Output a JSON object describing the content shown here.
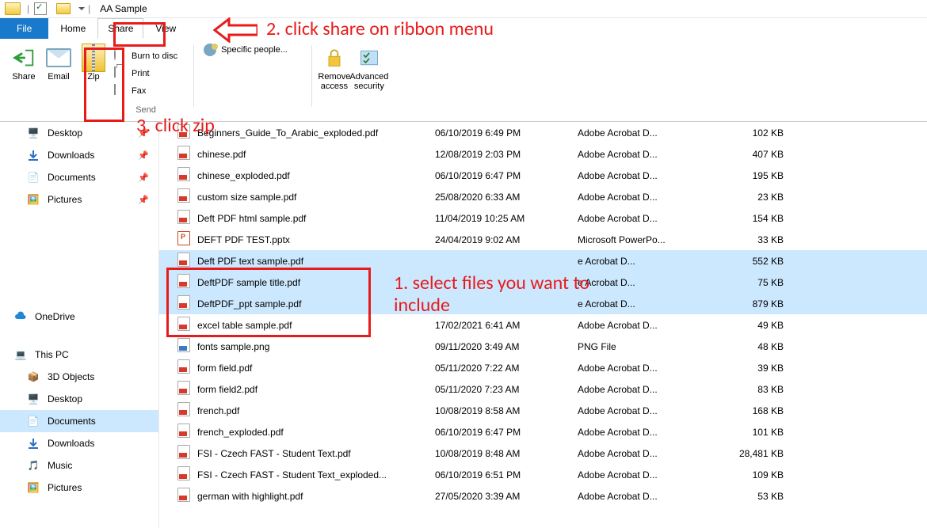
{
  "titlebar": {
    "window_title": "AA Sample"
  },
  "tabs": {
    "file": "File",
    "home": "Home",
    "share": "Share",
    "view": "View"
  },
  "ribbon": {
    "share": "Share",
    "email": "Email",
    "zip": "Zip",
    "burn": "Burn to disc",
    "print": "Print",
    "fax": "Fax",
    "send_group": "Send",
    "specific_people": "Specific people...",
    "remove_access": "Remove access",
    "advanced_security": "Advanced security"
  },
  "nav": {
    "desktop": "Desktop",
    "downloads": "Downloads",
    "documents": "Documents",
    "pictures": "Pictures",
    "onedrive": "OneDrive",
    "this_pc": "This PC",
    "three_d": "3D Objects",
    "desktop2": "Desktop",
    "documents2": "Documents",
    "downloads2": "Downloads",
    "music": "Music",
    "pictures2": "Pictures"
  },
  "files": [
    {
      "name": "Beginners_Guide_To_Arabic_exploded.pdf",
      "date": "06/10/2019 6:49 PM",
      "type": "Adobe Acrobat D...",
      "size": "102 KB",
      "icon": "pdf",
      "sel": false
    },
    {
      "name": "chinese.pdf",
      "date": "12/08/2019 2:03 PM",
      "type": "Adobe Acrobat D...",
      "size": "407 KB",
      "icon": "pdf",
      "sel": false
    },
    {
      "name": "chinese_exploded.pdf",
      "date": "06/10/2019 6:47 PM",
      "type": "Adobe Acrobat D...",
      "size": "195 KB",
      "icon": "pdf",
      "sel": false
    },
    {
      "name": "custom size sample.pdf",
      "date": "25/08/2020 6:33 AM",
      "type": "Adobe Acrobat D...",
      "size": "23 KB",
      "icon": "pdf",
      "sel": false
    },
    {
      "name": "Deft PDF html sample.pdf",
      "date": "11/04/2019 10:25 AM",
      "type": "Adobe Acrobat D...",
      "size": "154 KB",
      "icon": "pdf",
      "sel": false
    },
    {
      "name": "DEFT PDF TEST.pptx",
      "date": "24/04/2019 9:02 AM",
      "type": "Microsoft PowerPo...",
      "size": "33 KB",
      "icon": "pptx",
      "sel": false
    },
    {
      "name": "Deft PDF text sample.pdf",
      "date": "",
      "type": "e Acrobat D...",
      "size": "552 KB",
      "icon": "pdf",
      "sel": true
    },
    {
      "name": "DeftPDF sample title.pdf",
      "date": "",
      "type": "e Acrobat D...",
      "size": "75 KB",
      "icon": "pdf",
      "sel": true
    },
    {
      "name": "DeftPDF_ppt sample.pdf",
      "date": "",
      "type": "e Acrobat D...",
      "size": "879 KB",
      "icon": "pdf",
      "sel": true
    },
    {
      "name": "excel table sample.pdf",
      "date": "17/02/2021 6:41 AM",
      "type": "Adobe Acrobat D...",
      "size": "49 KB",
      "icon": "pdf",
      "sel": false
    },
    {
      "name": "fonts sample.png",
      "date": "09/11/2020 3:49 AM",
      "type": "PNG File",
      "size": "48 KB",
      "icon": "png",
      "sel": false
    },
    {
      "name": "form field.pdf",
      "date": "05/11/2020 7:22 AM",
      "type": "Adobe Acrobat D...",
      "size": "39 KB",
      "icon": "pdf",
      "sel": false
    },
    {
      "name": "form field2.pdf",
      "date": "05/11/2020 7:23 AM",
      "type": "Adobe Acrobat D...",
      "size": "83 KB",
      "icon": "pdf",
      "sel": false
    },
    {
      "name": "french.pdf",
      "date": "10/08/2019 8:58 AM",
      "type": "Adobe Acrobat D...",
      "size": "168 KB",
      "icon": "pdf",
      "sel": false
    },
    {
      "name": "french_exploded.pdf",
      "date": "06/10/2019 6:47 PM",
      "type": "Adobe Acrobat D...",
      "size": "101 KB",
      "icon": "pdf",
      "sel": false
    },
    {
      "name": "FSI - Czech FAST - Student Text.pdf",
      "date": "10/08/2019 8:48 AM",
      "type": "Adobe Acrobat D...",
      "size": "28,481 KB",
      "icon": "pdf",
      "sel": false
    },
    {
      "name": "FSI - Czech FAST - Student Text_exploded...",
      "date": "06/10/2019 6:51 PM",
      "type": "Adobe Acrobat D...",
      "size": "109 KB",
      "icon": "pdf",
      "sel": false
    },
    {
      "name": "german with highlight.pdf",
      "date": "27/05/2020 3:39 AM",
      "type": "Adobe Acrobat D...",
      "size": "53 KB",
      "icon": "pdf",
      "sel": false
    }
  ],
  "annotations": {
    "step1": "1. select files you want to include",
    "step2": "2. click share on ribbon menu",
    "step3": "3. click zip"
  }
}
